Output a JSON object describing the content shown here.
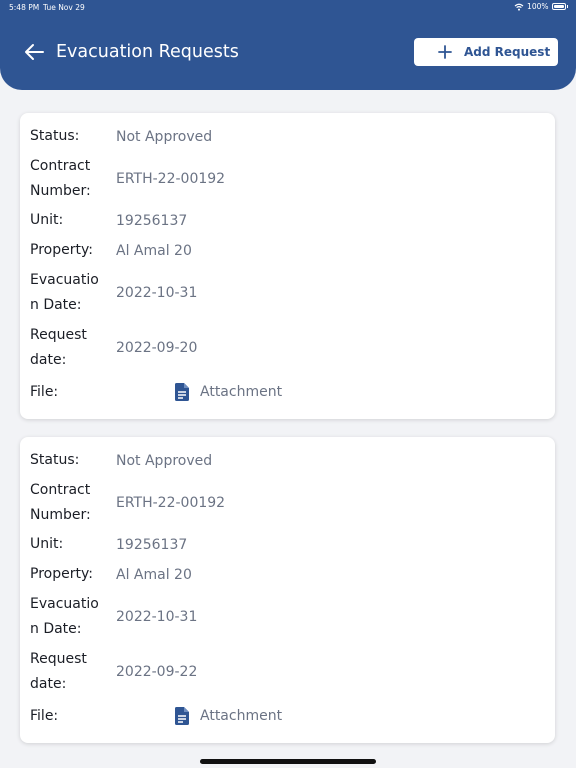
{
  "status_bar": {
    "time": "5:48 PM",
    "date": "Tue Nov 29",
    "battery": "100%"
  },
  "header": {
    "title": "Evacuation Requests",
    "add_button_label": "Add Request"
  },
  "labels": {
    "status": "Status:",
    "contract_l1": "Contract",
    "contract_l2": "Number:",
    "unit": "Unit:",
    "property": "Property:",
    "evac_l1": "Evacuatio",
    "evac_l2": "n Date:",
    "request_l1": "Request",
    "request_l2": "date:",
    "file": "File:"
  },
  "requests": [
    {
      "status": "Not Approved",
      "contract_number": "ERTH-22-00192",
      "unit": "19256137",
      "property": "Al Amal 20",
      "evacuation_date": "2022-10-31",
      "request_date": "2022-09-20",
      "file_label": "Attachment"
    },
    {
      "status": "Not Approved",
      "contract_number": "ERTH-22-00192",
      "unit": "19256137",
      "property": "Al Amal 20",
      "evacuation_date": "2022-10-31",
      "request_date": "2022-09-22",
      "file_label": "Attachment"
    }
  ],
  "colors": {
    "header": "#2f5593",
    "accent": "#2f5593",
    "value_text": "#6b7384"
  },
  "icons": {
    "back": "arrow-left-icon",
    "add": "plus-icon",
    "file": "document-icon"
  }
}
